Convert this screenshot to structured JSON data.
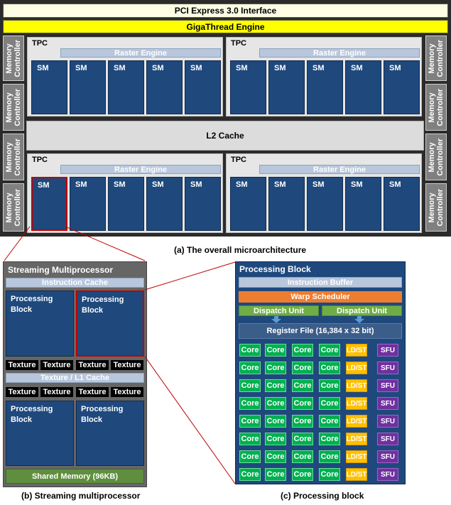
{
  "overall": {
    "pcie": "PCI Express 3.0 Interface",
    "gigathread": "GigaThread Engine",
    "memory_controller": "Memory\nController",
    "l2": "L2 Cache",
    "tpc": "TPC",
    "raster": "Raster Engine",
    "sm": "SM",
    "caption": "(a) The overall microarchitecture"
  },
  "sm_detail": {
    "title": "Streaming Multiprocessor",
    "instruction_cache": "Instruction Cache",
    "processing_block": "Processing\nBlock",
    "texture": "Texture",
    "tex_l1": "Texture / L1 Cache",
    "shared_memory": "Shared Memory (96KB)",
    "caption": "(b) Streaming multiprocessor"
  },
  "pb_detail": {
    "title": "Processing Block",
    "instruction_buffer": "Instruction Buffer",
    "warp_scheduler": "Warp Scheduler",
    "dispatch_unit": "Dispatch Unit",
    "register_file": "Register File (16,384 x 32 bit)",
    "core": "Core",
    "ldst": "LD/ST",
    "sfu": "SFU",
    "caption": "(c) Processing block"
  },
  "colors": {
    "sm_blue": "#1f497d",
    "raster_blue": "#b8c7dc",
    "highlight_red": "#c00000",
    "core_green": "#00b050",
    "ldst_yellow": "#ffc000",
    "sfu_purple": "#7030a0",
    "warp_orange": "#ed7d31",
    "dispatch_green": "#70ad47",
    "giga_yellow": "#ffff00"
  }
}
